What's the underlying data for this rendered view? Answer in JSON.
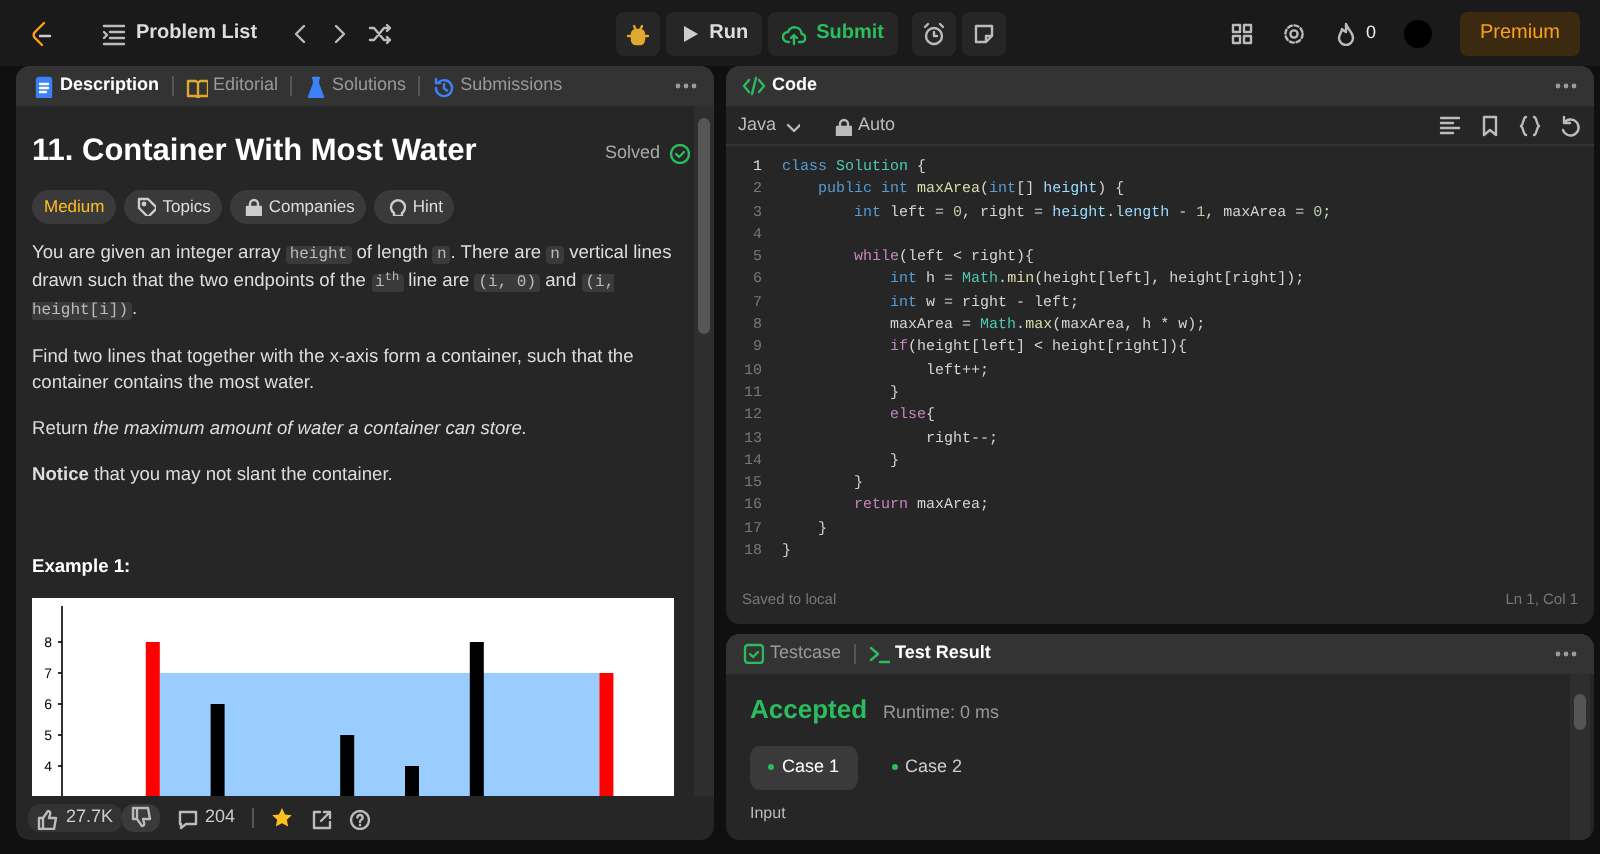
{
  "top_bar": {
    "problem_list": "Problem List",
    "run": "Run",
    "submit": "Submit",
    "streak": "0",
    "premium": "Premium"
  },
  "description_panel": {
    "tabs": [
      {
        "label": "Description",
        "selected": true
      },
      {
        "label": "Editorial",
        "selected": false
      },
      {
        "label": "Solutions",
        "selected": false
      },
      {
        "label": "Submissions",
        "selected": false
      }
    ],
    "title": "11. Container With Most Water",
    "status": "Solved",
    "tags": [
      {
        "kind": "difficulty",
        "label": "Medium"
      },
      {
        "kind": "topics",
        "label": "Topics"
      },
      {
        "kind": "companies",
        "label": "Companies"
      },
      {
        "kind": "hint",
        "label": "Hint"
      }
    ],
    "paragraphs": [
      [
        {
          "kind": "text",
          "text": "You are given an integer array "
        },
        {
          "kind": "code",
          "text": "height"
        },
        {
          "kind": "text",
          "text": " of length "
        },
        {
          "kind": "code",
          "text": "n"
        },
        {
          "kind": "text",
          "text": ". There are "
        },
        {
          "kind": "code",
          "text": "n"
        },
        {
          "kind": "text",
          "text": " vertical lines drawn such that the two endpoints of the "
        },
        {
          "kind": "code",
          "text": "i$^{th}$"
        },
        {
          "kind": "text",
          "text": " line are "
        },
        {
          "kind": "code",
          "text": "(i, 0)"
        },
        {
          "kind": "text",
          "text": " and "
        },
        {
          "kind": "code",
          "text": "(i, height[i])"
        },
        {
          "kind": "text",
          "text": "."
        }
      ],
      [
        {
          "kind": "text",
          "text": "Find two lines that together with the x-axis form a container, such that the container contains the most water."
        }
      ],
      [
        {
          "kind": "text",
          "text": "Return *the maximum amount of water a container can store.*"
        }
      ],
      [
        {
          "kind": "text",
          "text": "**Notice** that you may not slant the container."
        }
      ]
    ],
    "example_heading": "Example 1:",
    "example_figure": {
      "axis_labels": [
        "8",
        "7",
        "6",
        "5",
        "4"
      ]
    },
    "toolbar": {
      "likes": "27.7K",
      "comments": "204"
    }
  },
  "code_panel": {
    "title": "Code",
    "language": "Java",
    "mode": "Auto",
    "lines": [
      {
        "number": "1",
        "tokens": [
          {
            "kind": "keyword",
            "text": "class "
          },
          {
            "kind": "type",
            "text": "Solution"
          },
          {
            "kind": "plain",
            "text": " {"
          }
        ]
      },
      {
        "number": "2",
        "tokens": [
          {
            "kind": "keyword",
            "text": "    public int "
          },
          {
            "kind": "function",
            "text": "maxArea"
          },
          {
            "kind": "plain",
            "text": "("
          },
          {
            "kind": "keyword",
            "text": "int"
          },
          {
            "kind": "plain",
            "text": "[] "
          },
          {
            "kind": "variable",
            "text": "height"
          },
          {
            "kind": "plain",
            "text": ") {"
          }
        ]
      },
      {
        "number": "3",
        "tokens": [
          {
            "kind": "keyword",
            "text": "        int"
          },
          {
            "kind": "plain",
            "text": " left = "
          },
          {
            "kind": "number",
            "text": "0"
          },
          {
            "kind": "plain",
            "text": ", right = "
          },
          {
            "kind": "variable",
            "text": "height"
          },
          {
            "kind": "plain",
            "text": "."
          },
          {
            "kind": "variable",
            "text": "length"
          },
          {
            "kind": "plain",
            "text": " - "
          },
          {
            "kind": "number",
            "text": "1"
          },
          {
            "kind": "plain",
            "text": ", maxArea = "
          },
          {
            "kind": "number",
            "text": "0"
          },
          {
            "kind": "plain",
            "text": ";"
          }
        ]
      },
      {
        "number": "4"
      },
      {
        "number": "5",
        "tokens": [
          {
            "kind": "control",
            "text": "        while"
          },
          {
            "kind": "plain",
            "text": "(left < right){"
          }
        ]
      },
      {
        "number": "6",
        "tokens": [
          {
            "kind": "keyword",
            "text": "            int"
          },
          {
            "kind": "plain",
            "text": " h = "
          },
          {
            "kind": "type",
            "text": "Math"
          },
          {
            "kind": "plain",
            "text": "."
          },
          {
            "kind": "function",
            "text": "min"
          },
          {
            "kind": "plain",
            "text": "(height[left], height[right]);"
          }
        ]
      },
      {
        "number": "7",
        "tokens": [
          {
            "kind": "keyword",
            "text": "            int"
          },
          {
            "kind": "plain",
            "text": " w = right - left;"
          }
        ]
      },
      {
        "number": "8",
        "tokens": [
          {
            "kind": "plain",
            "text": "            maxArea = "
          },
          {
            "kind": "type",
            "text": "Math"
          },
          {
            "kind": "plain",
            "text": "."
          },
          {
            "kind": "function",
            "text": "max"
          },
          {
            "kind": "plain",
            "text": "(maxArea, h * w);"
          }
        ]
      },
      {
        "number": "9",
        "tokens": [
          {
            "kind": "control",
            "text": "            if"
          },
          {
            "kind": "plain",
            "text": "(height[left] < height[right]){"
          }
        ]
      },
      {
        "number": "10",
        "tokens": [
          {
            "kind": "plain",
            "text": "                left++;"
          }
        ]
      },
      {
        "number": "11",
        "tokens": [
          {
            "kind": "plain",
            "text": "            }"
          }
        ]
      },
      {
        "number": "12",
        "tokens": [
          {
            "kind": "control",
            "text": "            else"
          },
          {
            "kind": "plain",
            "text": "{"
          }
        ]
      },
      {
        "number": "13",
        "tokens": [
          {
            "kind": "plain",
            "text": "                right--;"
          }
        ]
      },
      {
        "number": "14",
        "tokens": [
          {
            "kind": "plain",
            "text": "            }"
          }
        ]
      },
      {
        "number": "15",
        "tokens": [
          {
            "kind": "plain",
            "text": "        }"
          }
        ]
      },
      {
        "number": "16",
        "tokens": [
          {
            "kind": "control",
            "text": "        return"
          },
          {
            "kind": "plain",
            "text": " maxArea;"
          }
        ]
      },
      {
        "number": "17",
        "tokens": [
          {
            "kind": "plain",
            "text": "    }"
          }
        ]
      },
      {
        "number": "18",
        "tokens": [
          {
            "kind": "plain",
            "text": "}"
          }
        ]
      }
    ],
    "footer_left": "Saved to local",
    "footer_right": "Ln 1, Col 1"
  },
  "test_panel": {
    "tabs": [
      {
        "label": "Testcase",
        "selected": false
      },
      {
        "label": "Test Result",
        "selected": true
      }
    ],
    "verdict": "Accepted",
    "runtime": "Runtime: 0 ms",
    "cases": [
      {
        "label": "Case 1",
        "selected": true
      },
      {
        "label": "Case 2",
        "selected": false
      }
    ],
    "section_label": "Input"
  }
}
